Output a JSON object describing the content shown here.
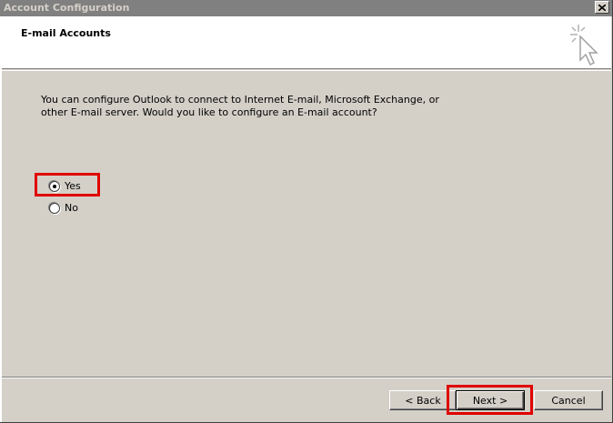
{
  "window": {
    "title": "Account Configuration",
    "close_glyph": "✕"
  },
  "header": {
    "title": "E-mail Accounts",
    "icon": "wizard-cursor-icon"
  },
  "body": {
    "message_line1": "You can configure Outlook to connect to Internet E-mail, Microsoft Exchange, or",
    "message_line2": "other E-mail server. Would you like to configure an E-mail account?",
    "options": [
      {
        "label": "Yes",
        "selected": true
      },
      {
        "label": "No",
        "selected": false
      }
    ]
  },
  "footer": {
    "back_label": "< Back",
    "next_label": "Next >",
    "cancel_label": "Cancel"
  },
  "colors": {
    "highlight": "#e00000",
    "dialog_bg": "#d4d0c8",
    "titlebar_bg": "#808080"
  }
}
